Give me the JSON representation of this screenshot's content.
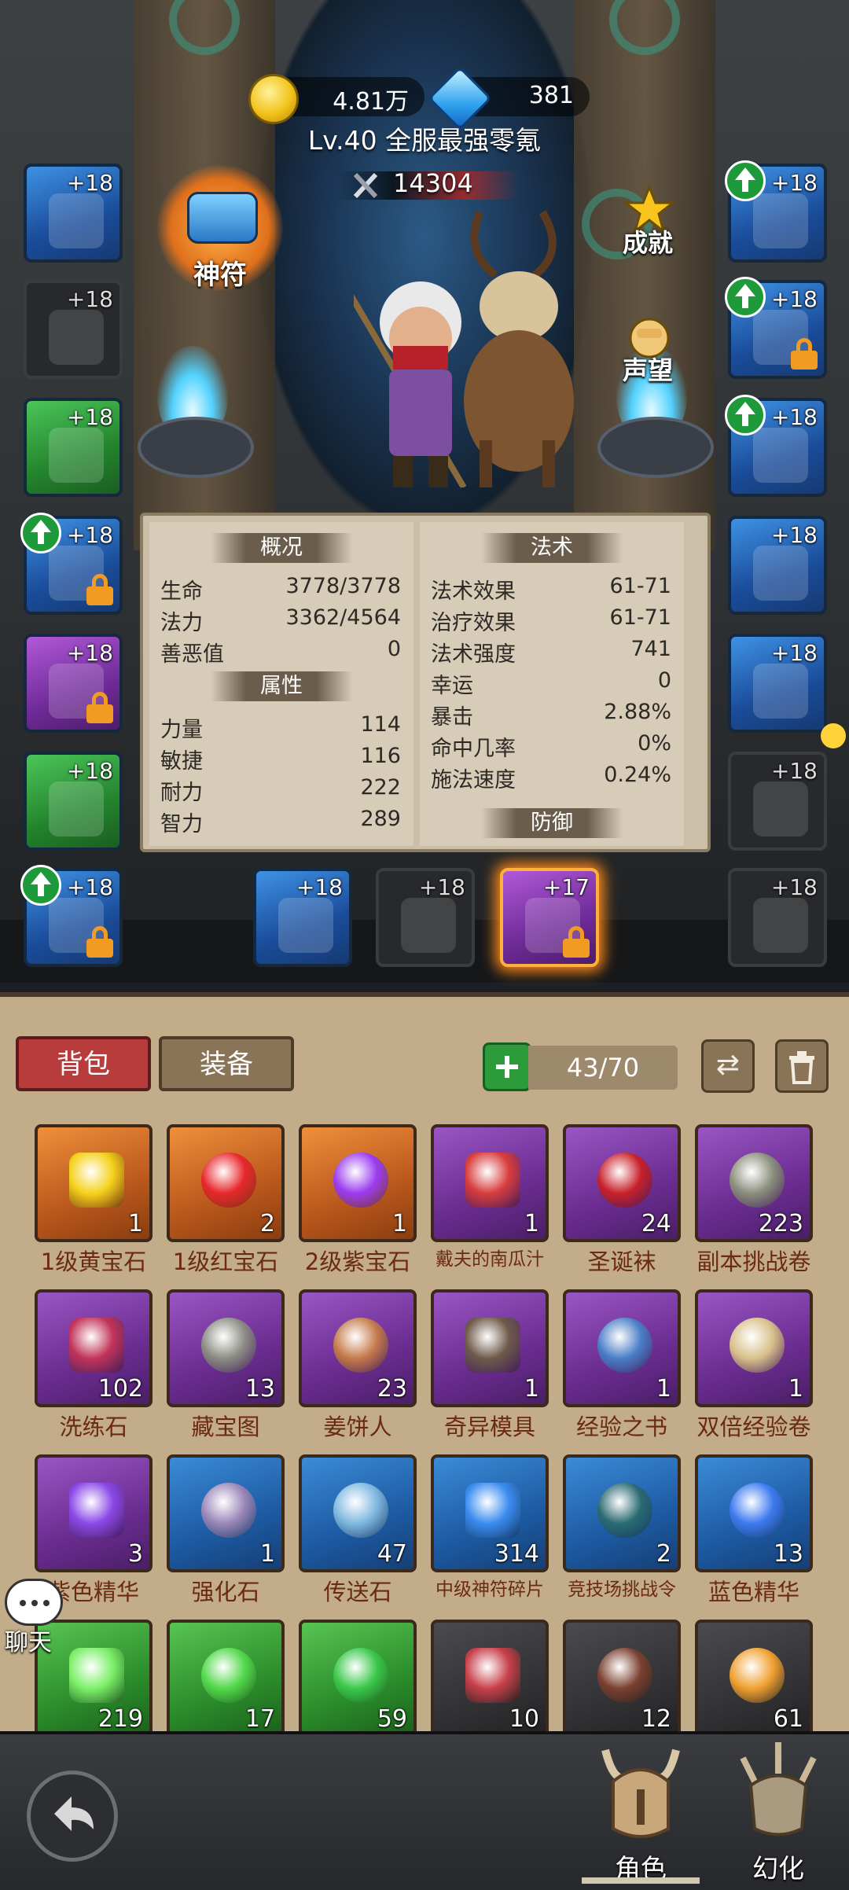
{
  "resources": {
    "gold": "4.81万",
    "diamonds": "381"
  },
  "player": {
    "title": "Lv.40 全服最强零氪",
    "power": "14304"
  },
  "side_buttons": {
    "rune": "神符",
    "achievement": "成就",
    "reputation": "声望"
  },
  "equipment": {
    "left": [
      {
        "level": "+18",
        "rarity": "blue"
      },
      {
        "level": "+18",
        "rarity": "grey"
      },
      {
        "level": "+18",
        "rarity": "green"
      },
      {
        "level": "+18",
        "rarity": "blue"
      },
      {
        "level": "+18",
        "rarity": "purple"
      },
      {
        "level": "+18",
        "rarity": "green"
      },
      {
        "level": "+18",
        "rarity": "blue"
      }
    ],
    "right": [
      {
        "level": "+18",
        "rarity": "blue"
      },
      {
        "level": "+18",
        "rarity": "blue"
      },
      {
        "level": "+18",
        "rarity": "blue"
      },
      {
        "level": "+18",
        "rarity": "blue"
      },
      {
        "level": "+18",
        "rarity": "blue"
      },
      {
        "level": "+18",
        "rarity": "grey"
      },
      {
        "level": "+18",
        "rarity": "grey"
      }
    ],
    "bottom": [
      {
        "level": "+18",
        "rarity": "blue"
      },
      {
        "level": "+18",
        "rarity": "grey"
      },
      {
        "level": "+17",
        "rarity": "purple"
      }
    ]
  },
  "stats": {
    "overview_header": "概况",
    "overview": [
      {
        "key": "生命",
        "value": "3778/3778"
      },
      {
        "key": "法力",
        "value": "3362/4564"
      },
      {
        "key": "善恶值",
        "value": "0"
      }
    ],
    "attributes_header": "属性",
    "attributes": [
      {
        "key": "力量",
        "value": "114"
      },
      {
        "key": "敏捷",
        "value": "116"
      },
      {
        "key": "耐力",
        "value": "222"
      },
      {
        "key": "智力",
        "value": "289"
      }
    ],
    "magic_header": "法术",
    "magic": [
      {
        "key": "法术效果",
        "value": "61-71"
      },
      {
        "key": "治疗效果",
        "value": "61-71"
      },
      {
        "key": "法术强度",
        "value": "741"
      },
      {
        "key": "幸运",
        "value": "0"
      },
      {
        "key": "暴击",
        "value": "2.88%"
      },
      {
        "key": "命中几率",
        "value": "0%"
      },
      {
        "key": "施法速度",
        "value": "0.24%"
      }
    ],
    "defense_header": "防御"
  },
  "inventory": {
    "tabs": {
      "bag": "背包",
      "equip": "装备"
    },
    "capacity": "43/70",
    "items": [
      {
        "name": "1级黄宝石",
        "count": "1",
        "rarity": "orange",
        "icon": "yellow-gem-icon",
        "color": "#f5d21c"
      },
      {
        "name": "1级红宝石",
        "count": "2",
        "rarity": "orange",
        "icon": "red-gem-icon",
        "color": "#e8262b"
      },
      {
        "name": "2级紫宝石",
        "count": "1",
        "rarity": "orange",
        "icon": "purple-gem-icon",
        "color": "#9b3cf0"
      },
      {
        "name": "戴夫的南瓜汁",
        "count": "1",
        "rarity": "purple",
        "icon": "juice-icon",
        "color": "#d83d3d"
      },
      {
        "name": "圣诞袜",
        "count": "24",
        "rarity": "purple",
        "icon": "christmas-sock-icon",
        "color": "#c8202a"
      },
      {
        "name": "副本挑战卷",
        "count": "223",
        "rarity": "purple",
        "icon": "scroll-icon",
        "color": "#8a8f7c"
      },
      {
        "name": "洗练石",
        "count": "102",
        "rarity": "purple",
        "icon": "rune-stone-icon",
        "color": "#c2345a"
      },
      {
        "name": "藏宝图",
        "count": "13",
        "rarity": "purple",
        "icon": "treasure-map-icon",
        "color": "#8c8c84"
      },
      {
        "name": "姜饼人",
        "count": "23",
        "rarity": "purple",
        "icon": "gingerbread-icon",
        "color": "#c57a4a"
      },
      {
        "name": "奇异模具",
        "count": "1",
        "rarity": "purple",
        "icon": "mold-icon",
        "color": "#6e5a4a"
      },
      {
        "name": "经验之书",
        "count": "1",
        "rarity": "purple",
        "icon": "book-icon",
        "color": "#4a7ec8"
      },
      {
        "name": "双倍经验卷",
        "count": "1",
        "rarity": "purple",
        "icon": "double-scroll-icon",
        "color": "#d8c08a"
      },
      {
        "name": "紫色精华",
        "count": "3",
        "rarity": "purple",
        "icon": "purple-essence-icon",
        "color": "#8b48e8"
      },
      {
        "name": "强化石",
        "count": "1",
        "rarity": "blue",
        "icon": "enhance-stone-icon",
        "color": "#9a86b8"
      },
      {
        "name": "传送石",
        "count": "47",
        "rarity": "blue",
        "icon": "teleport-stone-icon",
        "color": "#7fb8e0"
      },
      {
        "name": "中级神符碎片",
        "count": "314",
        "rarity": "blue",
        "icon": "rune-shard-icon",
        "color": "#3b8cf0"
      },
      {
        "name": "竞技场挑战令",
        "count": "2",
        "rarity": "blue",
        "icon": "arena-token-icon",
        "color": "#2a6a72"
      },
      {
        "name": "蓝色精华",
        "count": "13",
        "rarity": "blue",
        "icon": "blue-essence-icon",
        "color": "#3d7af0"
      },
      {
        "name": "",
        "count": "219",
        "rarity": "green",
        "icon": "green-gem-icon",
        "color": "#7df06a"
      },
      {
        "name": "",
        "count": "17",
        "rarity": "green",
        "icon": "green-orb-icon",
        "color": "#52d84a"
      },
      {
        "name": "",
        "count": "59",
        "rarity": "green",
        "icon": "green-crystal-icon",
        "color": "#3ac84a"
      },
      {
        "name": "",
        "count": "10",
        "rarity": "grey",
        "icon": "meat-icon",
        "color": "#c8404a"
      },
      {
        "name": "",
        "count": "12",
        "rarity": "grey",
        "icon": "claw-icon",
        "color": "#7a4030"
      },
      {
        "name": "",
        "count": "61",
        "rarity": "grey",
        "icon": "cocktail-icon",
        "color": "#f0a030"
      }
    ]
  },
  "chat": {
    "label": "聊天"
  },
  "nav": {
    "character": "角色",
    "transform": "幻化"
  }
}
